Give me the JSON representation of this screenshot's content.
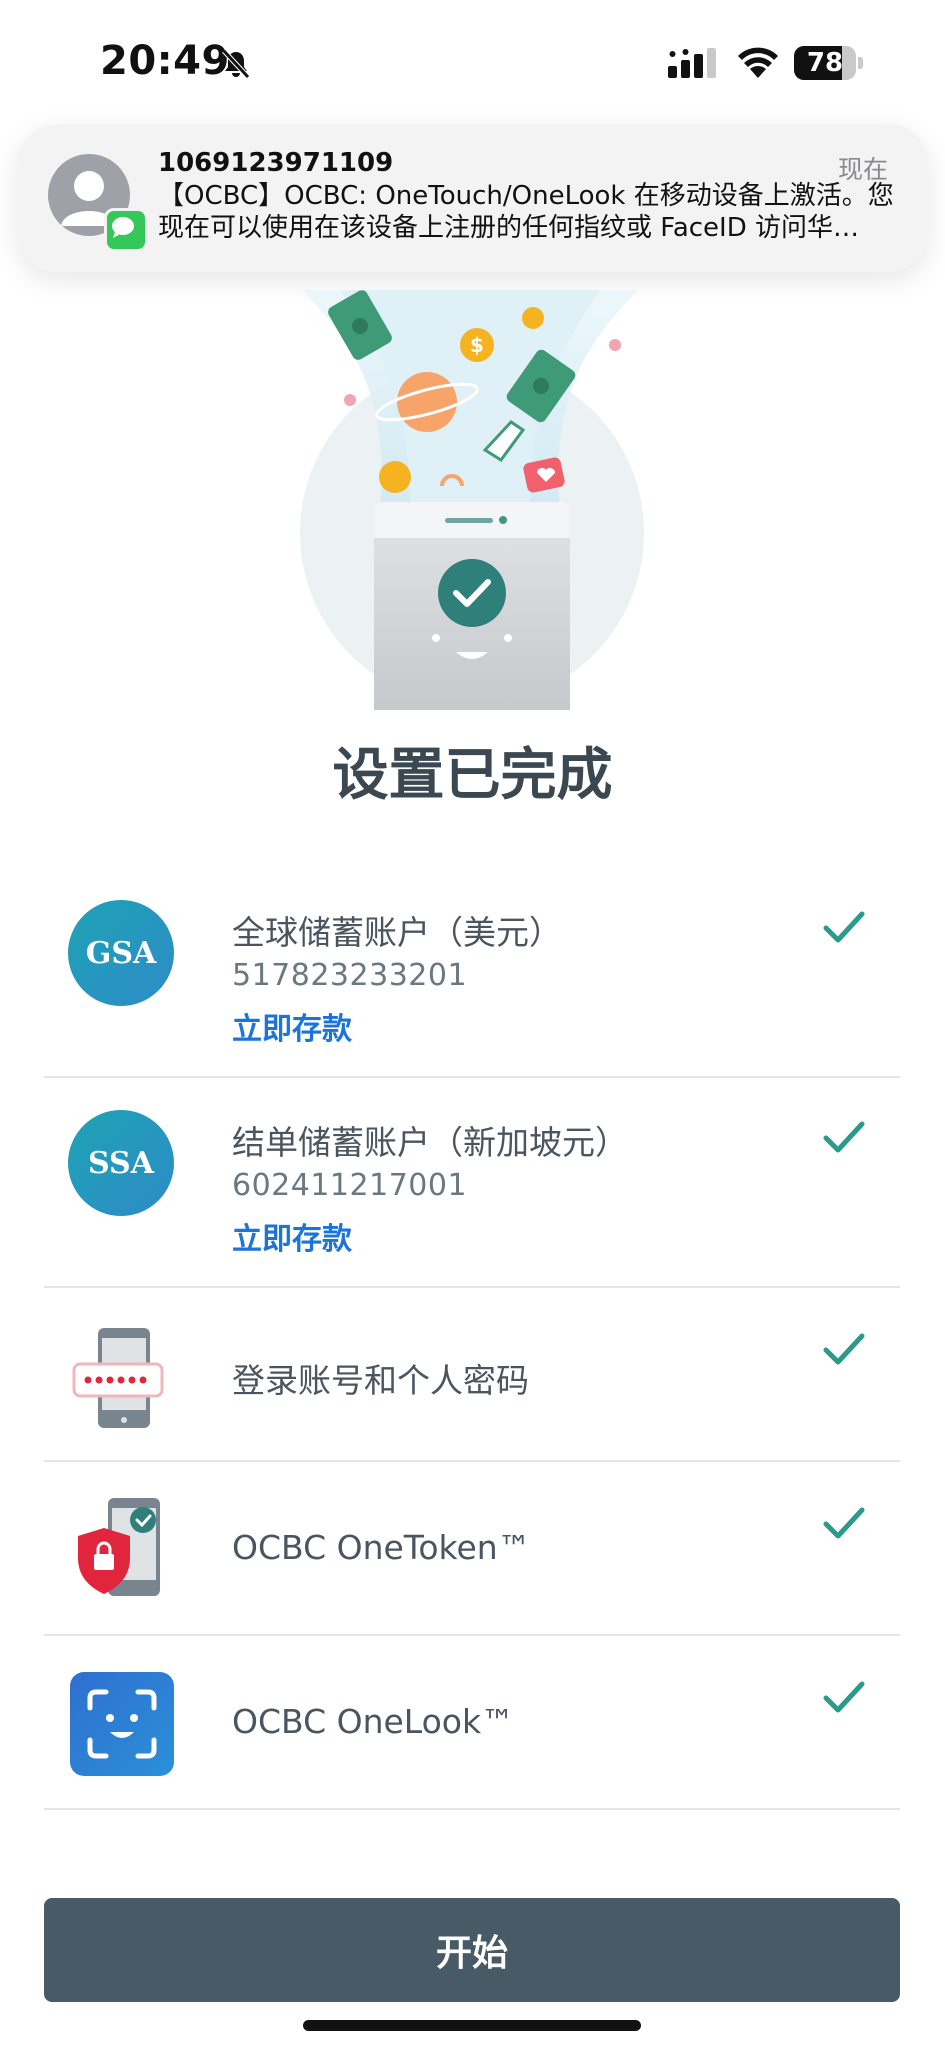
{
  "status_bar": {
    "time": "20:49",
    "battery": 78
  },
  "notification": {
    "sender": "1069123971109",
    "time": "现在",
    "body": "【OCBC】OCBC: OneTouch/OneLook 在移动设备上激活。您现在可以使用在该设备上注册的任何指纹或 FaceID 访问华…"
  },
  "page": {
    "title": "设置已完成"
  },
  "items": [
    {
      "icon": "GSA",
      "title": "全球储蓄账户（美元）",
      "number": "517823233201",
      "link": "立即存款"
    },
    {
      "icon": "SSA",
      "title": "结单储蓄账户（新加坡元）",
      "number": "602411217001",
      "link": "立即存款"
    },
    {
      "icon": "phone-password-icon",
      "title": "登录账号和个人密码"
    },
    {
      "icon": "onetoken-shield-icon",
      "title": "OCBC OneToken™"
    },
    {
      "icon": "face-scan-icon",
      "title": "OCBC OneLook™"
    }
  ],
  "colors": {
    "check": "#2a9a8a",
    "link": "#1b74d8",
    "button": "#475a66"
  },
  "start_button": {
    "label": "开始"
  }
}
